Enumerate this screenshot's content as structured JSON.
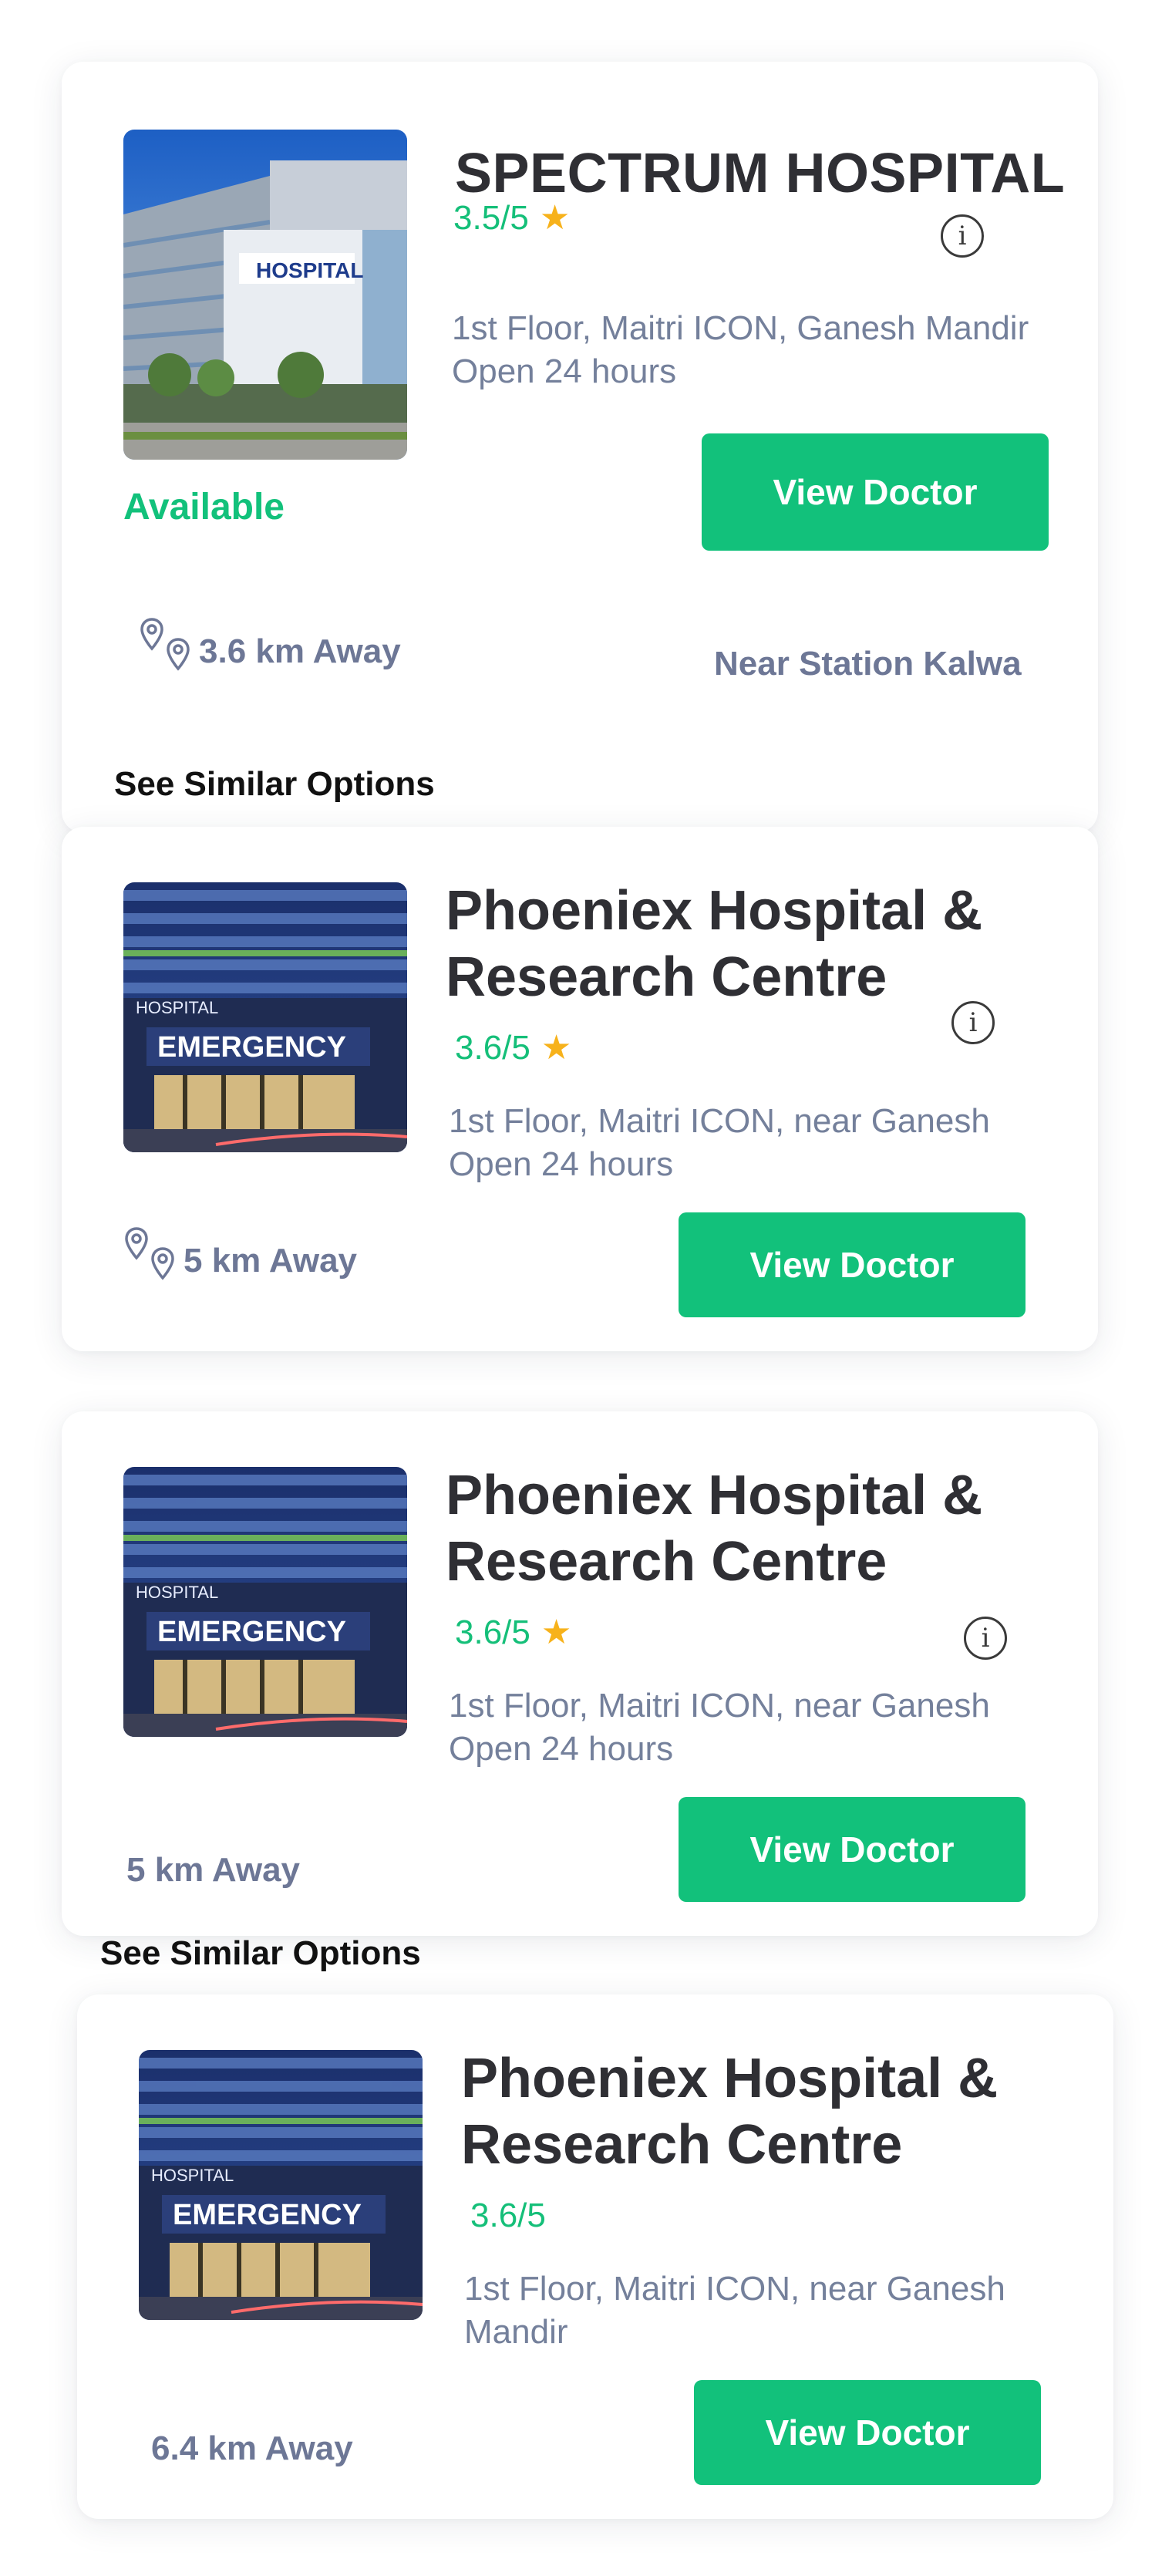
{
  "colors": {
    "accent": "#12c17b",
    "rating": "#15bf79",
    "star": "#f7b21b",
    "muted_text": "#74809b",
    "title_text": "#2f2f34"
  },
  "icons": {
    "star": "star-icon",
    "info": "info-icon",
    "location": "location-pin-icon"
  },
  "cards": [
    {
      "name": "SPECTRUM HOSPITAL",
      "rating": "3.5/5",
      "address_line1": "1st Floor, Maitri ICON,  Ganesh Mandir",
      "address_line2": "Open 24 hours",
      "button_label": "View Doctor",
      "availability": "Available",
      "distance": "3.6 km Away",
      "landmark": "Near Station Kalwa"
    },
    {
      "name_line1": "Phoeniex Hospital &",
      "name_line2": "Research Centre",
      "rating": "3.6/5",
      "address_line1": "1st Floor, Maitri ICON, near Ganesh",
      "address_line2": "Open 24 hours",
      "button_label": "View Doctor",
      "distance": "5 km Away",
      "image_sign_top": "HOSPITAL",
      "image_sign_main": "EMERGENCY"
    },
    {
      "name_line1": "Phoeniex Hospital &",
      "name_line2": "Research Centre",
      "rating": "3.6/5",
      "address_line1": "1st Floor, Maitri ICON, near Ganesh",
      "address_line2": "Open 24 hours",
      "button_label": "View Doctor",
      "distance": "5 km Away",
      "image_sign_top": "HOSPITAL",
      "image_sign_main": "EMERGENCY"
    },
    {
      "name_line1": "Phoeniex Hospital &",
      "name_line2": "Research Centre",
      "rating": "3.6/5",
      "address_line1": "1st Floor, Maitri ICON, near Ganesh",
      "address_line2": "Mandir",
      "button_label": "View Doctor",
      "distance": "6.4 km Away",
      "image_sign_top": "HOSPITAL",
      "image_sign_main": "EMERGENCY"
    }
  ],
  "similar_options_label": "See Similar Options",
  "similar_options_label_2": "See Similar Options",
  "spectrum_image_sign": "HOSPITAL"
}
